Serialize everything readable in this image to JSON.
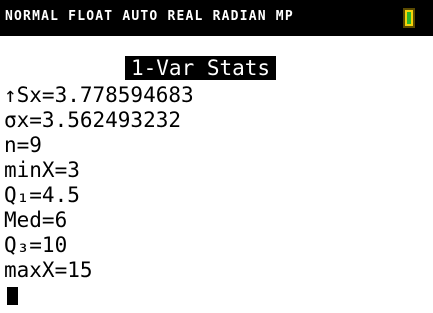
{
  "status_bar": {
    "text": "NORMAL FLOAT AUTO REAL RADIAN MP",
    "battery_icon": "battery-icon",
    "battery_color": "#f5d30a"
  },
  "screen": {
    "title": "1-Var Stats",
    "lines": [
      "↑Sx=3.778594683",
      " σx=3.562493232",
      " n=9",
      " minX=3",
      " Q₁=4.5",
      " Med=6",
      " Q₃=10",
      " maxX=15"
    ],
    "cursor": "cursor-block"
  }
}
